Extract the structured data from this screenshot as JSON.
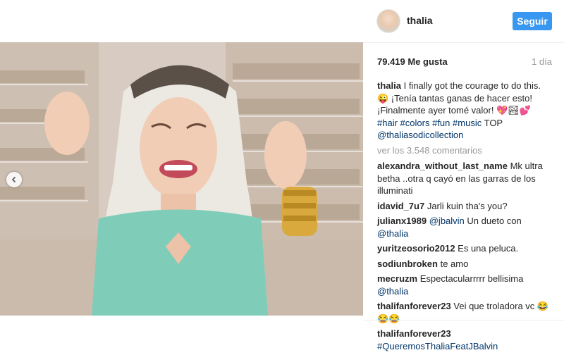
{
  "post": {
    "username": "thalia",
    "follow_label": "Seguir",
    "likes": "79.419 Me gusta",
    "time": "1 día",
    "caption_user": "thalia",
    "caption_text": "I finally got the courage to do this. 😜 ¡Tenía tantas ganas de hacer esto! ¡Finalmente ayer tomé valor! 💖🏞💕",
    "caption_tags": [
      "#hair",
      "#colors",
      "#fun",
      "#music"
    ],
    "caption_top": "TOP",
    "caption_mention": "@thaliasodicollection",
    "view_more": "ver los 3.548 comentarios"
  },
  "comments": [
    {
      "user": "alexandra_without_last_name",
      "text": "Mk ultra betha ..otra q cayó en las garras de los illuminati"
    },
    {
      "user": "idavid_7u7",
      "text": "Jarli kuin tha's you?"
    },
    {
      "user": "julianx1989",
      "mention": "@jbalvin",
      "text": "Un dueto con",
      "mention2": "@thalia"
    },
    {
      "user": "yuritzeosorio2012",
      "text": "Es una peluca."
    },
    {
      "user": "sodiunbroken",
      "text": "te amo"
    },
    {
      "user": "mecruzm",
      "text": "Espectacularrrrr bellisima",
      "mention": "@thalia"
    },
    {
      "user": "thalifanforever23",
      "text": "Vei que troladora vc 😂😂😂"
    },
    {
      "user": "thalifanforever23",
      "tag": "#QueremosThaliaFeatJBalvin"
    }
  ],
  "colors": {
    "accent": "#3897f0",
    "link": "#003569",
    "muted": "#999999"
  },
  "icons": {
    "carousel_prev": "chevron-left-icon"
  }
}
